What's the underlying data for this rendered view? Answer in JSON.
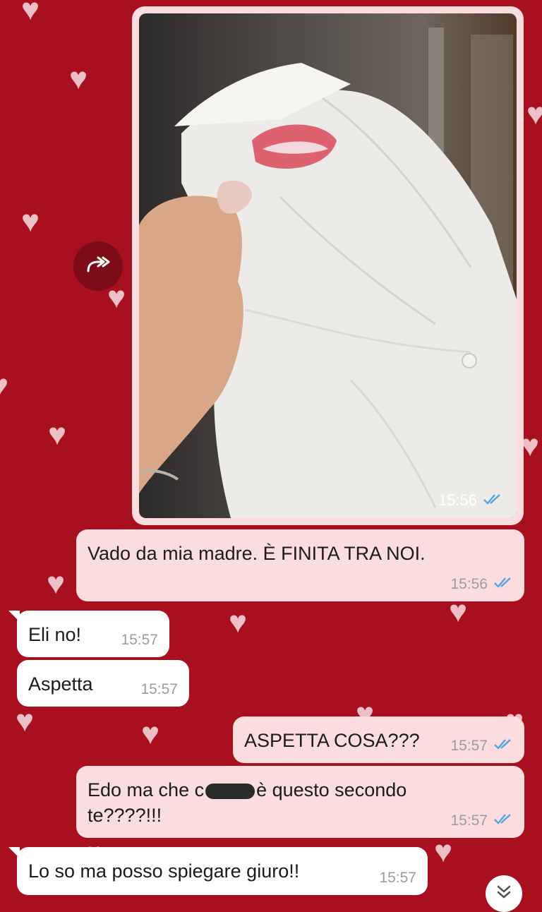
{
  "messages": {
    "photo": {
      "time": "15:56"
    },
    "m1": {
      "text": "Vado da mia madre. È FINITA TRA NOI.",
      "time": "15:56"
    },
    "m2": {
      "text": "Eli no!",
      "time": "15:57"
    },
    "m3": {
      "text": "Aspetta",
      "time": "15:57"
    },
    "m4": {
      "text": "ASPETTA COSA???",
      "time": "15:57"
    },
    "m5": {
      "line1_a": "Edo ma che c",
      "line1_b": "è questo secondo",
      "line2": "te????!!!",
      "time": "15:57"
    },
    "m6": {
      "text": "Lo so ma posso spiegare giuro!!",
      "time": "15:57"
    }
  },
  "icons": {
    "forward": "forward-icon",
    "read_receipt": "double-check-icon",
    "scroll_down": "chevron-double-down-icon"
  },
  "colors": {
    "wallpaper": "#a8101f",
    "hearts": "#f2c9cf",
    "outgoing_bubble": "#fbdde0",
    "incoming_bubble": "#ffffff",
    "read_receipt": "#4fa5e0"
  }
}
